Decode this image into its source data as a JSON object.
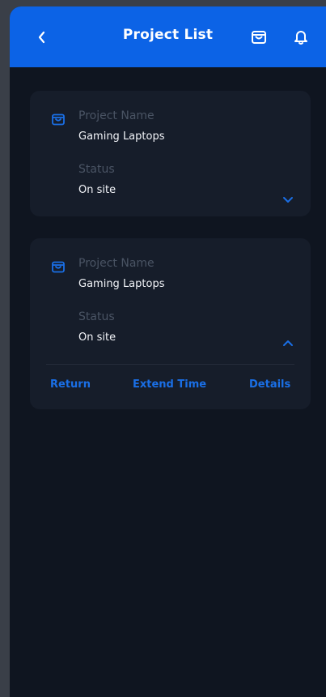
{
  "header": {
    "title": "Project List",
    "icons": [
      "back-icon",
      "shopping-bag-icon",
      "bell-icon"
    ]
  },
  "projects": [
    {
      "name_label": "Project Name",
      "name_value": "Gaming Laptops",
      "status_label": "Status",
      "status_value": "On site",
      "expanded": false
    },
    {
      "name_label": "Project Name",
      "name_value": "Gaming Laptops",
      "status_label": "Status",
      "status_value": "On site",
      "expanded": true,
      "actions": [
        "Return",
        "Extend Time",
        "Details"
      ]
    }
  ],
  "colors": {
    "appbar": "#0c63e6",
    "background": "#0f1520",
    "card": "#161d2a",
    "accent": "#1a6fe6",
    "label": "#4a5464",
    "value": "#f2f4f8"
  }
}
